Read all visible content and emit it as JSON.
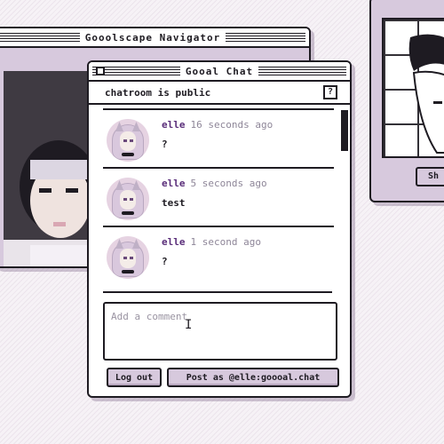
{
  "navigator": {
    "title": "Gooolscape Navigator"
  },
  "side_window": {
    "button_label": "Sh"
  },
  "chat": {
    "title": "Gooal Chat",
    "status": "chatroom is public",
    "help_icon": "?",
    "messages": [
      {
        "user": "elle",
        "time": "16 seconds ago",
        "text": "?"
      },
      {
        "user": "elle",
        "time": "5 seconds ago",
        "text": "test"
      },
      {
        "user": "elle",
        "time": "1 second ago",
        "text": "?"
      }
    ],
    "comment_placeholder": "Add a comment",
    "logout_label": "Log out",
    "post_label": "Post as @elle:goooal.chat"
  },
  "colors": {
    "lavender": "#d7c9dd",
    "ink": "#1e1b22",
    "username": "#5a2e7a",
    "timestamp": "#8e8698"
  }
}
